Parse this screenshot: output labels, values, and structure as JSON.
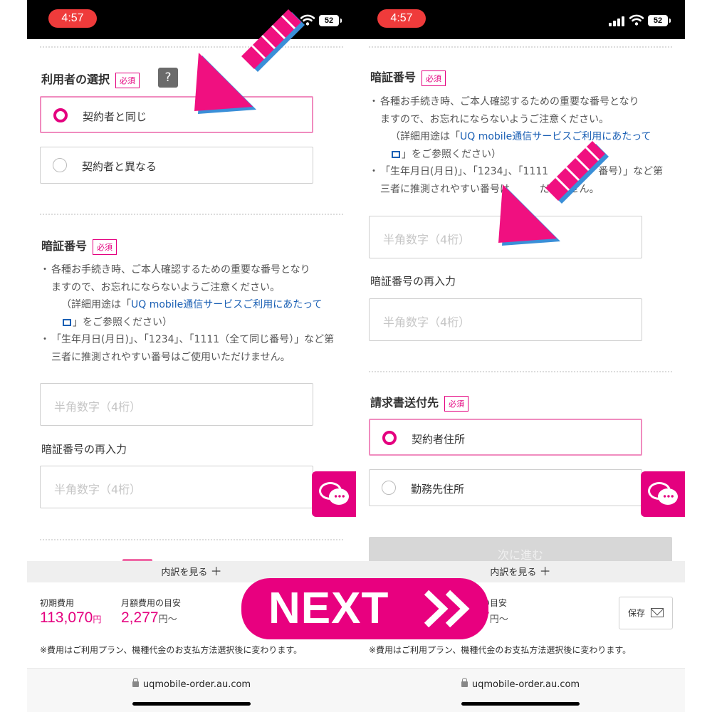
{
  "status": {
    "time": "4:57",
    "battery": "52"
  },
  "left": {
    "user_section": {
      "title": "利用者の選択",
      "required": "必須",
      "help": "?",
      "options": [
        "契約者と同じ",
        "契約者と異なる"
      ]
    },
    "pin_section": {
      "title": "暗証番号",
      "required": "必須",
      "note1_line1": "各種お手続き時、ご本人確認するための重要な番号となり",
      "note1_line2": "ますので、お忘れにならないようご注意ください。",
      "note1_sub_prefix": "（詳細用途は「",
      "note1_link": "UQ mobile通信サービスご利用にあたって",
      "note1_sub_suffix": "」をご参照ください）",
      "note2_line1": "「生年月日(月日)」、「1234」、「1111（全て同じ番号）」など第",
      "note2_line2": "三者に推測されやすい番号はご使用いただけません。",
      "placeholder": "半角数字（4桁）",
      "reenter_label": "暗証番号の再入力",
      "reenter_placeholder": "半角数字（4桁）"
    }
  },
  "right": {
    "pin_section": {
      "title": "暗証番号",
      "required": "必須",
      "note1_line1": "各種お手続き時、ご本人確認するための重要な番号となり",
      "note1_line2": "ますので、お忘れにならないようご注意ください。",
      "note1_sub_prefix": "（詳細用途は「",
      "note1_link": "UQ mobile通信サービスご利用にあたって",
      "note1_sub_suffix": "」をご参照ください）",
      "note2_line1": "「生年月日(月日)」、「1234」、「1111",
      "note2_line1_tail": "番号）」など第",
      "note2_line2": "三者に推測されやすい番号は",
      "note2_line2_tail": "だけません。",
      "placeholder": "半角数字（4桁）",
      "reenter_label": "暗証番号の再入力",
      "reenter_placeholder": "半角数字（4桁）"
    },
    "invoice_section": {
      "title": "請求書送付先",
      "required": "必須",
      "options": [
        "契約者住所",
        "勤務先住所"
      ]
    },
    "next_button": "次に進む"
  },
  "summary": {
    "breakdown": "内訳を見る",
    "initial_label": "初期費用",
    "initial_value": "113,070",
    "yen": "円",
    "monthly_label": "月額費用の目安",
    "monthly_label_partial": "の目安",
    "monthly_value": "2,277",
    "monthly_value_partial": "7",
    "monthly_suffix": "円〜",
    "note": "※費用はご利用プラン、機種代金のお支払方法選択後に変わります。",
    "save": "保存"
  },
  "browser": {
    "url": "uqmobile-order.au.com"
  },
  "overlay": {
    "next_label": "NEXT"
  },
  "colors": {
    "accent": "#e4007f",
    "arrow": "#f01080",
    "arrow_shadow": "#3a8fd8"
  }
}
